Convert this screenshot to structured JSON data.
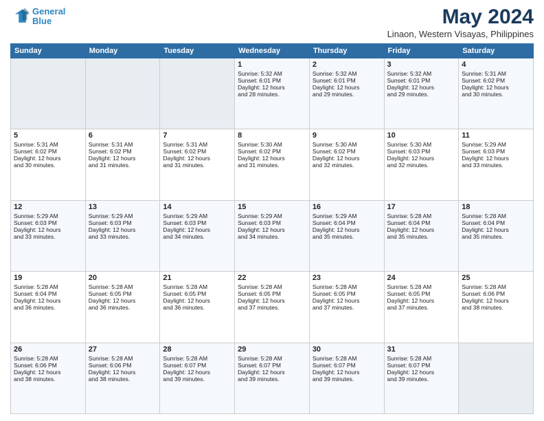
{
  "logo": {
    "line1": "General",
    "line2": "Blue"
  },
  "title": "May 2024",
  "location": "Linaon, Western Visayas, Philippines",
  "weekdays": [
    "Sunday",
    "Monday",
    "Tuesday",
    "Wednesday",
    "Thursday",
    "Friday",
    "Saturday"
  ],
  "weeks": [
    [
      {
        "day": "",
        "empty": true,
        "lines": []
      },
      {
        "day": "",
        "empty": true,
        "lines": []
      },
      {
        "day": "",
        "empty": true,
        "lines": []
      },
      {
        "day": "1",
        "empty": false,
        "lines": [
          "Sunrise: 5:32 AM",
          "Sunset: 6:01 PM",
          "Daylight: 12 hours",
          "and 28 minutes."
        ]
      },
      {
        "day": "2",
        "empty": false,
        "lines": [
          "Sunrise: 5:32 AM",
          "Sunset: 6:01 PM",
          "Daylight: 12 hours",
          "and 29 minutes."
        ]
      },
      {
        "day": "3",
        "empty": false,
        "lines": [
          "Sunrise: 5:32 AM",
          "Sunset: 6:01 PM",
          "Daylight: 12 hours",
          "and 29 minutes."
        ]
      },
      {
        "day": "4",
        "empty": false,
        "lines": [
          "Sunrise: 5:31 AM",
          "Sunset: 6:02 PM",
          "Daylight: 12 hours",
          "and 30 minutes."
        ]
      }
    ],
    [
      {
        "day": "5",
        "empty": false,
        "lines": [
          "Sunrise: 5:31 AM",
          "Sunset: 6:02 PM",
          "Daylight: 12 hours",
          "and 30 minutes."
        ]
      },
      {
        "day": "6",
        "empty": false,
        "lines": [
          "Sunrise: 5:31 AM",
          "Sunset: 6:02 PM",
          "Daylight: 12 hours",
          "and 31 minutes."
        ]
      },
      {
        "day": "7",
        "empty": false,
        "lines": [
          "Sunrise: 5:31 AM",
          "Sunset: 6:02 PM",
          "Daylight: 12 hours",
          "and 31 minutes."
        ]
      },
      {
        "day": "8",
        "empty": false,
        "lines": [
          "Sunrise: 5:30 AM",
          "Sunset: 6:02 PM",
          "Daylight: 12 hours",
          "and 31 minutes."
        ]
      },
      {
        "day": "9",
        "empty": false,
        "lines": [
          "Sunrise: 5:30 AM",
          "Sunset: 6:02 PM",
          "Daylight: 12 hours",
          "and 32 minutes."
        ]
      },
      {
        "day": "10",
        "empty": false,
        "lines": [
          "Sunrise: 5:30 AM",
          "Sunset: 6:03 PM",
          "Daylight: 12 hours",
          "and 32 minutes."
        ]
      },
      {
        "day": "11",
        "empty": false,
        "lines": [
          "Sunrise: 5:29 AM",
          "Sunset: 6:03 PM",
          "Daylight: 12 hours",
          "and 33 minutes."
        ]
      }
    ],
    [
      {
        "day": "12",
        "empty": false,
        "lines": [
          "Sunrise: 5:29 AM",
          "Sunset: 6:03 PM",
          "Daylight: 12 hours",
          "and 33 minutes."
        ]
      },
      {
        "day": "13",
        "empty": false,
        "lines": [
          "Sunrise: 5:29 AM",
          "Sunset: 6:03 PM",
          "Daylight: 12 hours",
          "and 33 minutes."
        ]
      },
      {
        "day": "14",
        "empty": false,
        "lines": [
          "Sunrise: 5:29 AM",
          "Sunset: 6:03 PM",
          "Daylight: 12 hours",
          "and 34 minutes."
        ]
      },
      {
        "day": "15",
        "empty": false,
        "lines": [
          "Sunrise: 5:29 AM",
          "Sunset: 6:03 PM",
          "Daylight: 12 hours",
          "and 34 minutes."
        ]
      },
      {
        "day": "16",
        "empty": false,
        "lines": [
          "Sunrise: 5:29 AM",
          "Sunset: 6:04 PM",
          "Daylight: 12 hours",
          "and 35 minutes."
        ]
      },
      {
        "day": "17",
        "empty": false,
        "lines": [
          "Sunrise: 5:28 AM",
          "Sunset: 6:04 PM",
          "Daylight: 12 hours",
          "and 35 minutes."
        ]
      },
      {
        "day": "18",
        "empty": false,
        "lines": [
          "Sunrise: 5:28 AM",
          "Sunset: 6:04 PM",
          "Daylight: 12 hours",
          "and 35 minutes."
        ]
      }
    ],
    [
      {
        "day": "19",
        "empty": false,
        "lines": [
          "Sunrise: 5:28 AM",
          "Sunset: 6:04 PM",
          "Daylight: 12 hours",
          "and 36 minutes."
        ]
      },
      {
        "day": "20",
        "empty": false,
        "lines": [
          "Sunrise: 5:28 AM",
          "Sunset: 6:05 PM",
          "Daylight: 12 hours",
          "and 36 minutes."
        ]
      },
      {
        "day": "21",
        "empty": false,
        "lines": [
          "Sunrise: 5:28 AM",
          "Sunset: 6:05 PM",
          "Daylight: 12 hours",
          "and 36 minutes."
        ]
      },
      {
        "day": "22",
        "empty": false,
        "lines": [
          "Sunrise: 5:28 AM",
          "Sunset: 6:05 PM",
          "Daylight: 12 hours",
          "and 37 minutes."
        ]
      },
      {
        "day": "23",
        "empty": false,
        "lines": [
          "Sunrise: 5:28 AM",
          "Sunset: 6:05 PM",
          "Daylight: 12 hours",
          "and 37 minutes."
        ]
      },
      {
        "day": "24",
        "empty": false,
        "lines": [
          "Sunrise: 5:28 AM",
          "Sunset: 6:05 PM",
          "Daylight: 12 hours",
          "and 37 minutes."
        ]
      },
      {
        "day": "25",
        "empty": false,
        "lines": [
          "Sunrise: 5:28 AM",
          "Sunset: 6:06 PM",
          "Daylight: 12 hours",
          "and 38 minutes."
        ]
      }
    ],
    [
      {
        "day": "26",
        "empty": false,
        "lines": [
          "Sunrise: 5:28 AM",
          "Sunset: 6:06 PM",
          "Daylight: 12 hours",
          "and 38 minutes."
        ]
      },
      {
        "day": "27",
        "empty": false,
        "lines": [
          "Sunrise: 5:28 AM",
          "Sunset: 6:06 PM",
          "Daylight: 12 hours",
          "and 38 minutes."
        ]
      },
      {
        "day": "28",
        "empty": false,
        "lines": [
          "Sunrise: 5:28 AM",
          "Sunset: 6:07 PM",
          "Daylight: 12 hours",
          "and 39 minutes."
        ]
      },
      {
        "day": "29",
        "empty": false,
        "lines": [
          "Sunrise: 5:28 AM",
          "Sunset: 6:07 PM",
          "Daylight: 12 hours",
          "and 39 minutes."
        ]
      },
      {
        "day": "30",
        "empty": false,
        "lines": [
          "Sunrise: 5:28 AM",
          "Sunset: 6:07 PM",
          "Daylight: 12 hours",
          "and 39 minutes."
        ]
      },
      {
        "day": "31",
        "empty": false,
        "lines": [
          "Sunrise: 5:28 AM",
          "Sunset: 6:07 PM",
          "Daylight: 12 hours",
          "and 39 minutes."
        ]
      },
      {
        "day": "",
        "empty": true,
        "lines": []
      }
    ]
  ]
}
